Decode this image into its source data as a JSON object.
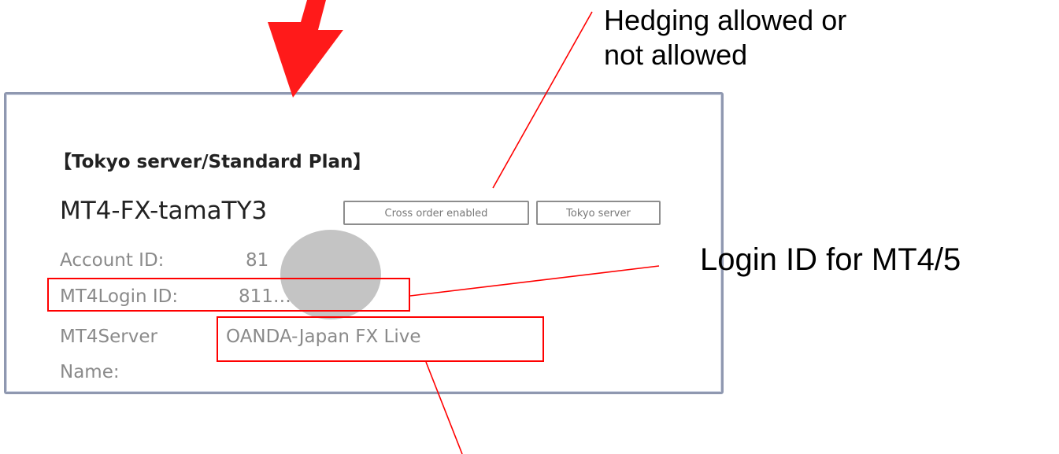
{
  "annotations": {
    "hedging_line1": "Hedging allowed or",
    "hedging_line2": "not allowed",
    "login_id_note": "Login ID for  MT4/5"
  },
  "account_card": {
    "plan_title": "【Tokyo server/Standard Plan】",
    "account_name": "MT4-FX-tamaTY3",
    "tags": [
      "Cross order enabled",
      "Tokyo server"
    ],
    "rows": [
      {
        "label": "Account ID:",
        "value": "81"
      },
      {
        "label": "MT4Login ID:",
        "value": "811… ……3"
      },
      {
        "label_line1": "MT4Server",
        "label_line2": "Name:",
        "value": "OANDA-Japan FX Live"
      }
    ]
  },
  "colors": {
    "arrow": "#ff1a1a",
    "highlight_box": "#ff0000",
    "callout_line": "#ff0000",
    "panel_border": "#8f98b0",
    "redaction": "#c4c4c4"
  },
  "icons": [
    "down-arrow-icon"
  ]
}
